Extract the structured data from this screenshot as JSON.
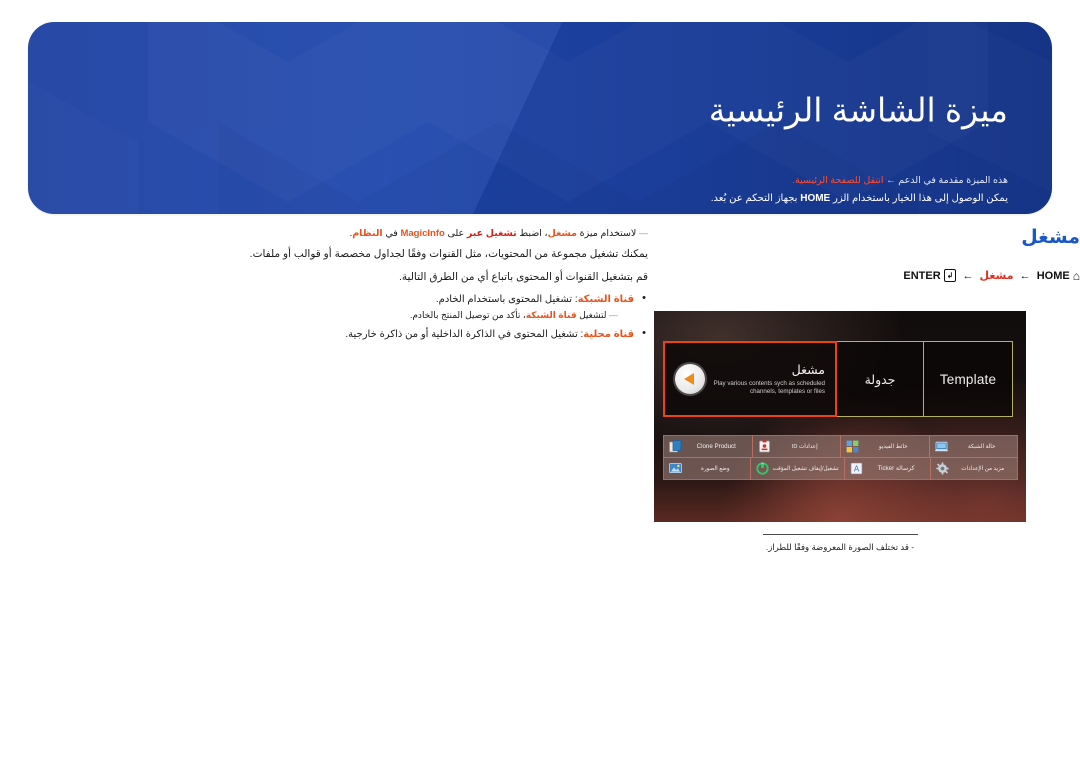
{
  "banner": {
    "title": "ميزة الشاشة الرئيسية",
    "sub_prefix": "هذه الميزة مقدمة في الدعم ←",
    "sub_link": "انتقل للصفحة الرئيسية.",
    "sub_line2_before": "يمكن الوصول إلى هذا الخيار باستخدام الزر",
    "sub_line2_key": "HOME",
    "sub_line2_after": "بجهاز التحكم عن بُعد."
  },
  "left": {
    "note_dash": "―",
    "note_a": "لاستخدام ميزة",
    "note_player": "مشغل",
    "note_b": "، اضبط",
    "note_setting": "تشغيل عبر",
    "note_c": "على",
    "note_magicinfo": "MagicInfo",
    "note_d": "في",
    "note_system": "النظام",
    "note_e": ".",
    "para1": "يمكنك تشغيل مجموعة من المحتويات، مثل القنوات وفقًا لجداول مخصصة أو قوالب أو ملفات.",
    "para2": "قم بتشغيل القنوات أو المحتوى باتباع أي من الطرق التالية.",
    "bullet1_term": "قناة الشبكة",
    "bullet1_text": ": تشغيل المحتوى باستخدام الخادم.",
    "subnote_dash": "―",
    "subnote_a": "لتشغيل",
    "subnote_term": "قناة الشبكة",
    "subnote_b": "، تأكد من توصيل المنتج بالخادم.",
    "bullet2_term": "قناة محلية",
    "bullet2_text": ": تشغيل المحتوى في الذاكرة الداخلية أو من ذاكرة خارجية."
  },
  "right": {
    "section_title": "مشغل",
    "breadcrumb_home_icon": "home-icon",
    "breadcrumb_home": "HOME",
    "breadcrumb_arrow": "←",
    "breadcrumb_player": "مشغل",
    "breadcrumb_enter": "ENTER",
    "breadcrumb_enter_icon": "enter-key-icon"
  },
  "tv": {
    "tiles": [
      {
        "label": "مشغل",
        "kind": "player",
        "selected": true,
        "desc": "Play various contents sych as scheduled channels, templates or files",
        "icon": "play-circle-icon"
      },
      {
        "label": "جدولة",
        "kind": "arabic",
        "selected": false
      },
      {
        "label": "Template",
        "kind": "latin",
        "selected": false
      }
    ],
    "grid": [
      [
        {
          "label": "Clone Product",
          "latin": true,
          "icon": "clone-product-icon",
          "color": "#e8e4dd"
        },
        {
          "label": "إعدادات ID",
          "latin": false,
          "icon": "id-settings-icon",
          "color": "#e2e2e2"
        },
        {
          "label": "حائط الفيديو",
          "latin": false,
          "icon": "video-wall-icon",
          "color": "#4f9ad8"
        },
        {
          "label": "حالة الشبكة",
          "latin": false,
          "icon": "network-status-icon",
          "color": "#7fb6e8"
        }
      ],
      [
        {
          "label": "وضع الصورة",
          "latin": false,
          "icon": "picture-mode-icon",
          "color": "#5aa0dd"
        },
        {
          "label": "تشغيل/إيقاف تشغيل المؤقت",
          "latin": false,
          "icon": "on-off-timer-icon",
          "color": "#39c06a"
        },
        {
          "label": "Ticker كرسالة",
          "latin": true,
          "icon": "ticker-icon",
          "color": "#dfe7f0"
        },
        {
          "label": "مزيد من الإعدادات",
          "latin": false,
          "icon": "more-settings-icon",
          "color": "#9aa3ac"
        }
      ]
    ]
  },
  "caption": {
    "text": "‐ قد تختلف الصورة المعروضة وفقًا للطراز."
  },
  "colors": {
    "banner_blue": "#1d46ad",
    "section_blue": "#1b58c6",
    "accent_orange": "#e8541f",
    "accent_red": "#d0231b",
    "selection_orange": "#e8450f",
    "tile_border": "#b3b06a"
  }
}
